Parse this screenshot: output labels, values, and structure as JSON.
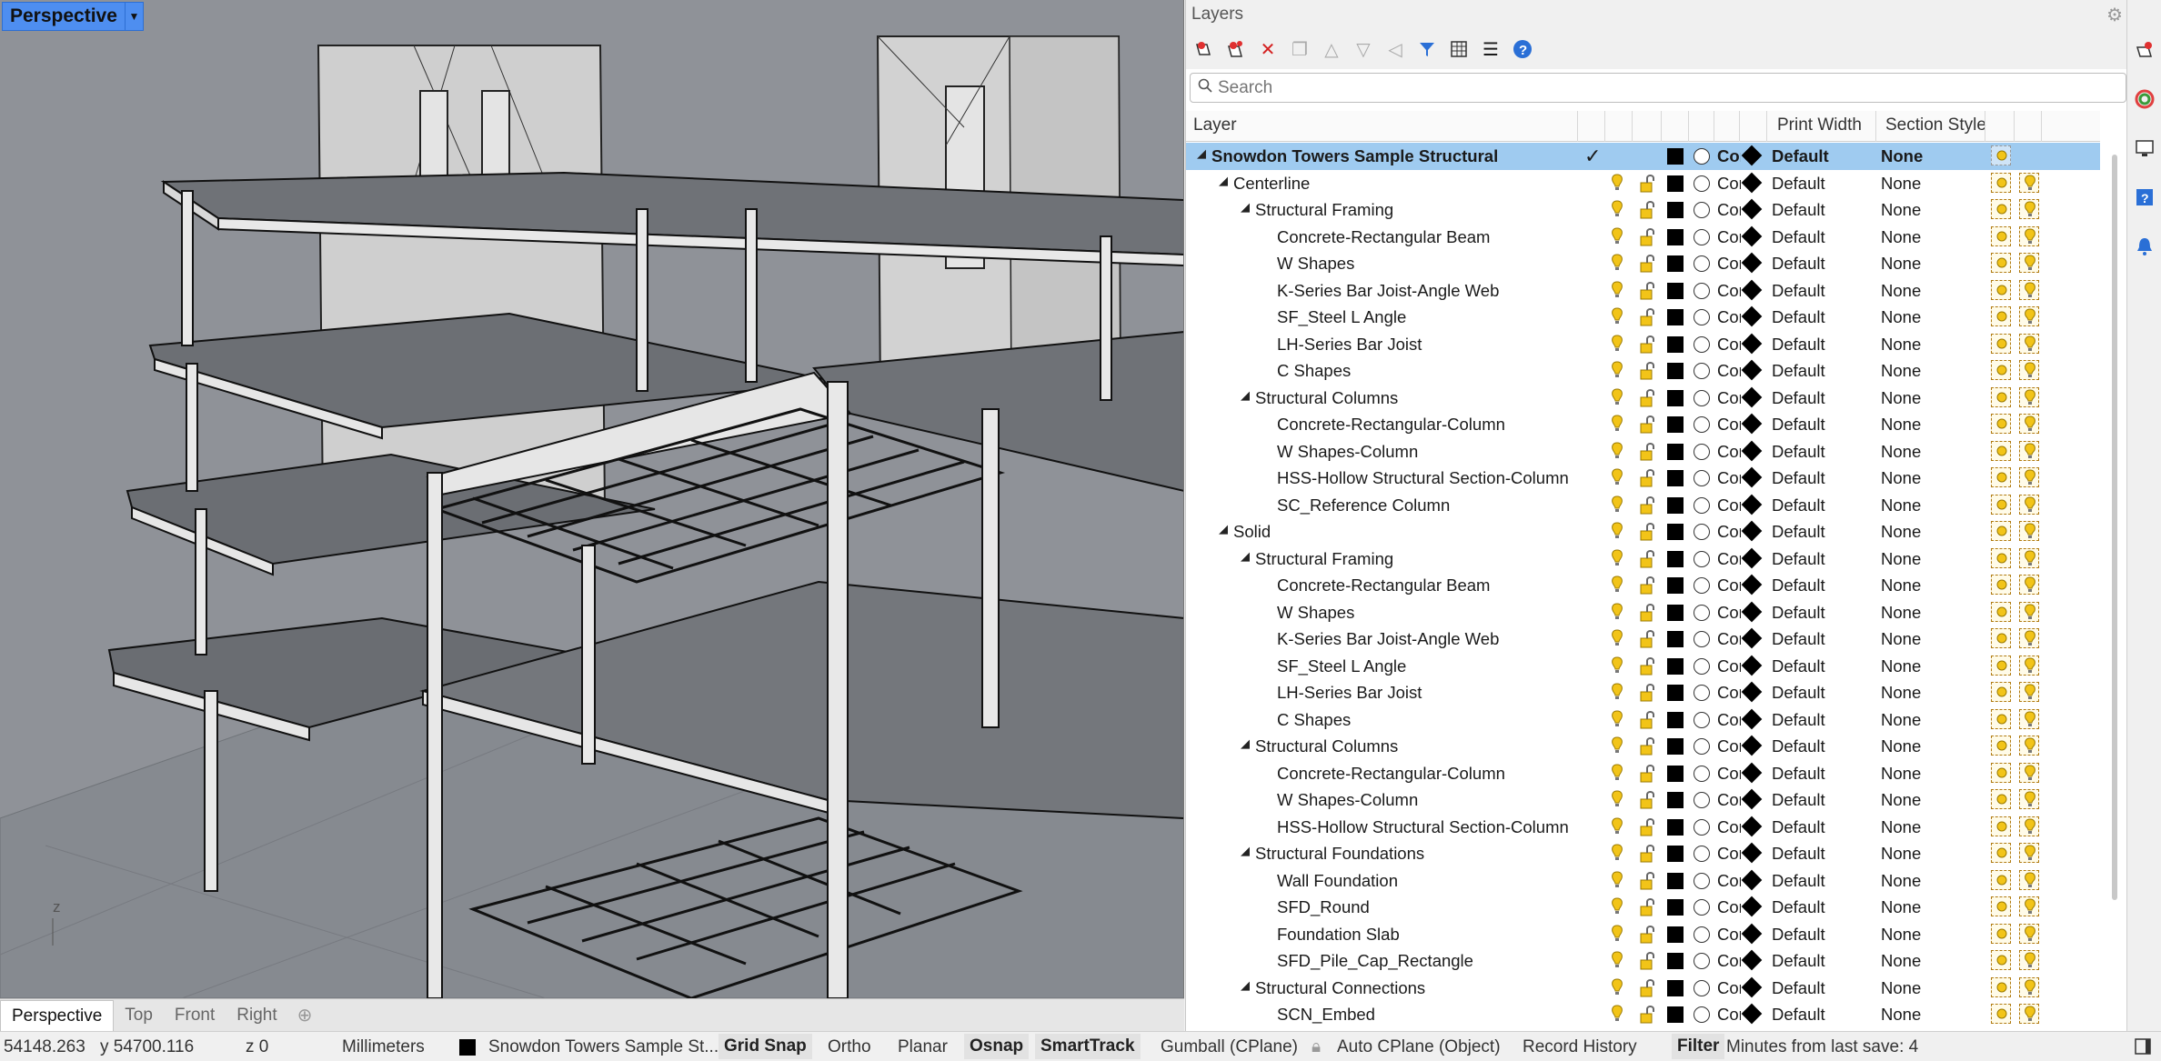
{
  "viewport": {
    "title": "Perspective",
    "axis_label": "z"
  },
  "viewport_tabs": [
    "Perspective",
    "Top",
    "Front",
    "Right"
  ],
  "panel": {
    "title": "Layers",
    "search_placeholder": "Search",
    "columns": {
      "layer": "Layer",
      "print_width": "Print Width",
      "section_style": "Section Style"
    },
    "toolbar_icons": [
      "new-layer-icon",
      "new-sublayer-icon",
      "delete-icon",
      "copy-icon",
      "move-up-icon",
      "move-down-icon",
      "move-out-icon",
      "filter-icon",
      "table-icon",
      "menu-icon",
      "help-icon"
    ],
    "layers": [
      {
        "name": "Snowdon Towers Sample Structural",
        "level": 0,
        "expanded": true,
        "current": true
      },
      {
        "name": "Centerline",
        "level": 1,
        "expanded": true
      },
      {
        "name": "Structural Framing",
        "level": 2,
        "expanded": true
      },
      {
        "name": "Concrete-Rectangular Beam",
        "level": 3
      },
      {
        "name": "W Shapes",
        "level": 3
      },
      {
        "name": "K-Series Bar Joist-Angle Web",
        "level": 3
      },
      {
        "name": "SF_Steel L Angle",
        "level": 3
      },
      {
        "name": "LH-Series Bar Joist",
        "level": 3
      },
      {
        "name": "C Shapes",
        "level": 3
      },
      {
        "name": "Structural Columns",
        "level": 2,
        "expanded": true
      },
      {
        "name": "Concrete-Rectangular-Column",
        "level": 3
      },
      {
        "name": "W Shapes-Column",
        "level": 3
      },
      {
        "name": "HSS-Hollow Structural Section-Column",
        "level": 3
      },
      {
        "name": "SC_Reference Column",
        "level": 3
      },
      {
        "name": "Solid",
        "level": 1,
        "expanded": true
      },
      {
        "name": "Structural Framing",
        "level": 2,
        "expanded": true
      },
      {
        "name": "Concrete-Rectangular Beam",
        "level": 3
      },
      {
        "name": "W Shapes",
        "level": 3
      },
      {
        "name": "K-Series Bar Joist-Angle Web",
        "level": 3
      },
      {
        "name": "SF_Steel L Angle",
        "level": 3
      },
      {
        "name": "LH-Series Bar Joist",
        "level": 3
      },
      {
        "name": "C Shapes",
        "level": 3
      },
      {
        "name": "Structural Columns",
        "level": 2,
        "expanded": true
      },
      {
        "name": "Concrete-Rectangular-Column",
        "level": 3
      },
      {
        "name": "W Shapes-Column",
        "level": 3
      },
      {
        "name": "HSS-Hollow Structural Section-Column",
        "level": 3
      },
      {
        "name": "Structural Foundations",
        "level": 2,
        "expanded": true
      },
      {
        "name": "Wall Foundation",
        "level": 3
      },
      {
        "name": "SFD_Round",
        "level": 3
      },
      {
        "name": "Foundation Slab",
        "level": 3
      },
      {
        "name": "SFD_Pile_Cap_Rectangle",
        "level": 3
      },
      {
        "name": "Structural Connections",
        "level": 2,
        "expanded": true
      },
      {
        "name": "SCN_Embed",
        "level": 3
      }
    ],
    "row_defaults": {
      "color": "#000000",
      "continuous_abbrev": "Cor",
      "print_width": "Default",
      "section_style": "None"
    }
  },
  "status": {
    "x": "54148.263",
    "y": "y 54700.116",
    "z": "z 0",
    "units": "Millimeters",
    "layer": "Snowdon Towers Sample St...",
    "grid_snap": "Grid Snap",
    "ortho": "Ortho",
    "planar": "Planar",
    "osnap": "Osnap",
    "smarttrack": "SmartTrack",
    "gumball": "Gumball (CPlane)",
    "autocplane": "Auto CPlane (Object)",
    "record_history": "Record History",
    "filter": "Filter",
    "minutes": "Minutes from last save: 4"
  },
  "colors": {
    "selected_row": "#9fcbf0",
    "viewport_title": "#4e8ef0",
    "bulb": "#f2c418"
  }
}
